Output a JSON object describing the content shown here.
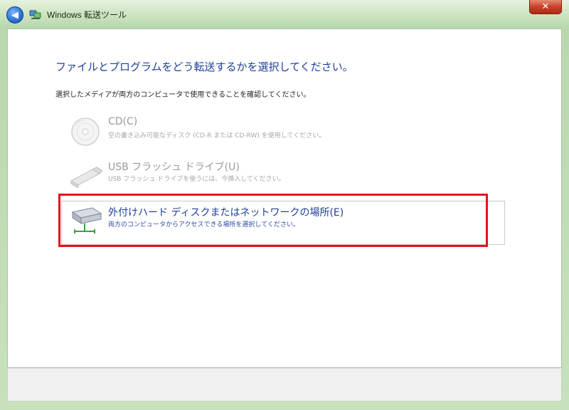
{
  "window": {
    "title": "Windows 転送ツール",
    "back_label": "◀",
    "close_label": "✕"
  },
  "heading": "ファイルとプログラムをどう転送するかを選択してください。",
  "instruction": "選択したメディアが両方のコンピュータで使用できることを確認してください。",
  "options": [
    {
      "title": "CD(C)",
      "description": "空の書き込み可能なディスク (CD-R または CD-RW) を使用してください。",
      "icon": "cd-icon",
      "enabled": false
    },
    {
      "title": "USB フラッシュ ドライブ(U)",
      "description": "USB フラッシュ ドライブを使うには、今挿入してください。",
      "icon": "usb-drive-icon",
      "enabled": false
    },
    {
      "title": "外付けハード ディスクまたはネットワークの場所(E)",
      "description": "両方のコンピュータからアクセスできる場所を選択してください。",
      "icon": "external-disk-network-icon",
      "enabled": true
    }
  ],
  "colors": {
    "heading": "#1e3f9a",
    "highlight": "#e2141c",
    "disabled_text": "#9a9a9a"
  }
}
